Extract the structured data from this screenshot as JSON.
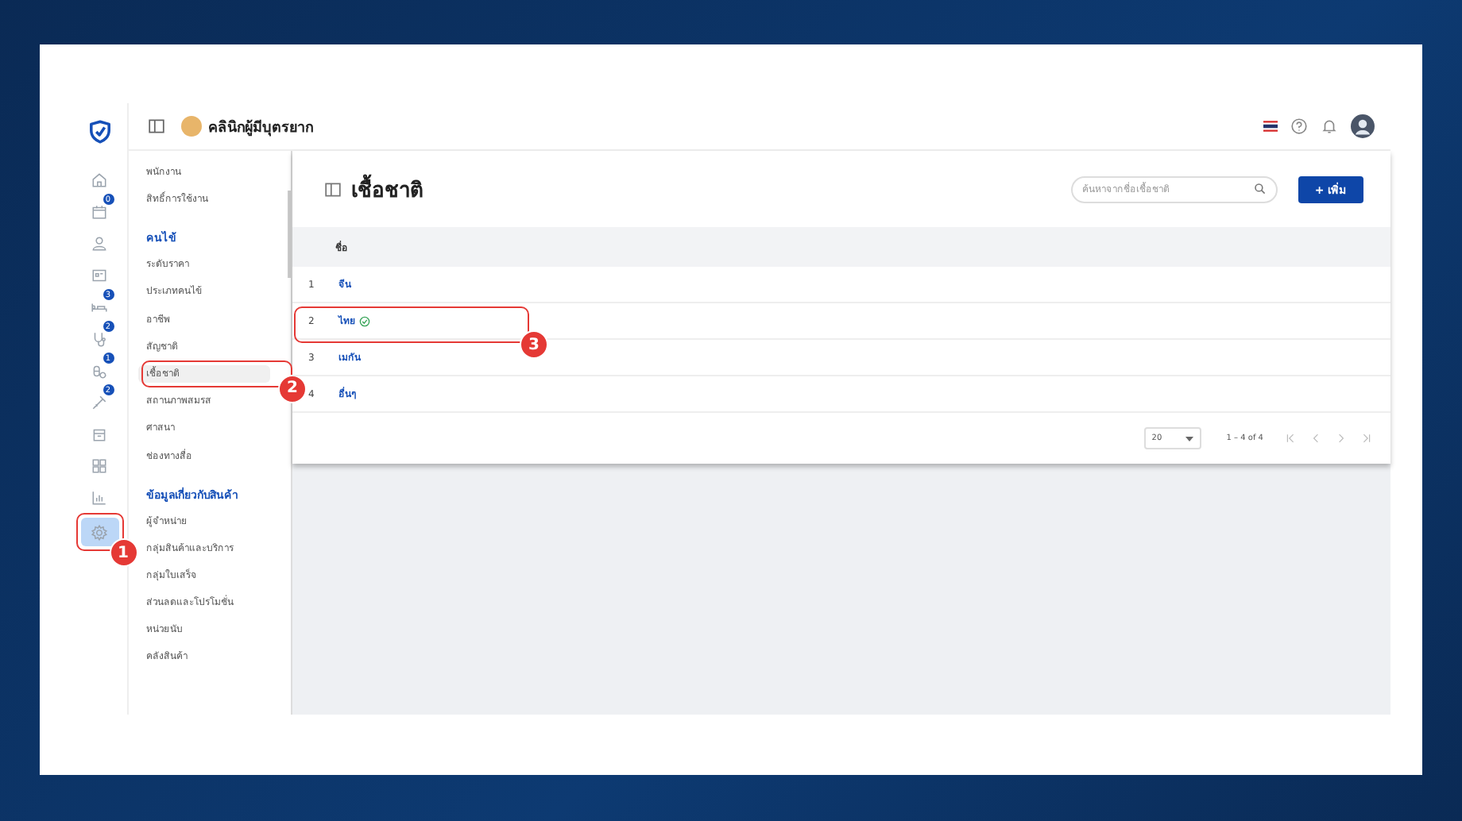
{
  "header": {
    "clinic_name": "คลินิกผู้มีบุตรยาก"
  },
  "rail": [
    {
      "selected": false
    },
    {
      "badge": "0",
      "selected": false
    },
    {
      "selected": false
    },
    {
      "selected": false
    },
    {
      "badge": "3",
      "selected": false
    },
    {
      "badge": "2",
      "selected": false
    },
    {
      "badge": "1",
      "selected": false
    },
    {
      "badge": "2",
      "selected": false
    },
    {
      "selected": false
    },
    {
      "selected": false
    },
    {
      "selected": false
    },
    {
      "selected": true,
      "callout": "1"
    }
  ],
  "sidebar": {
    "groups": [
      {
        "items": [
          {
            "label": "พนักงาน",
            "selected": false
          },
          {
            "label": "สิทธิ์การใช้งาน",
            "selected": false
          }
        ]
      },
      {
        "title": "คนไข้",
        "items": [
          {
            "label": "ระดับราคา",
            "selected": false
          },
          {
            "label": "ประเภทคนไข้",
            "selected": false
          },
          {
            "label": "อาชีพ",
            "selected": false
          },
          {
            "label": "สัญชาติ",
            "selected": false
          },
          {
            "label": "เชื้อชาติ",
            "selected": true,
            "callout": "2"
          },
          {
            "label": "สถานภาพสมรส",
            "selected": false
          },
          {
            "label": "ศาสนา",
            "selected": false
          },
          {
            "label": "ช่องทางสื่อ",
            "selected": false
          }
        ]
      },
      {
        "title": "ข้อมูลเกี่ยวกับสินค้า",
        "items": [
          {
            "label": "ผู้จำหน่าย",
            "selected": false
          },
          {
            "label": "กลุ่มสินค้าและบริการ",
            "selected": false
          },
          {
            "label": "กลุ่มใบเสร็จ",
            "selected": false
          },
          {
            "label": "ส่วนลดและโปรโมชั่น",
            "selected": false
          },
          {
            "label": "หน่วยนับ",
            "selected": false
          },
          {
            "label": "คลังสินค้า",
            "selected": false
          }
        ]
      }
    ]
  },
  "page": {
    "title": "เชื้อชาติ",
    "search": {
      "placeholder": "ค้นหาจากชื่อเชื้อชาติ"
    },
    "add_button": "+ เพิ่ม"
  },
  "table": {
    "columns": [
      "ชื่อ"
    ],
    "rows": [
      {
        "index": "1",
        "name": "จีน",
        "verified": false
      },
      {
        "index": "2",
        "name": "ไทย",
        "verified": true,
        "callout": "3"
      },
      {
        "index": "3",
        "name": "เมกัน",
        "verified": false
      },
      {
        "index": "4",
        "name": "อื่นๆ",
        "verified": false
      }
    ]
  },
  "pagination": {
    "page_size": "20",
    "range": "1 – 4 of 4"
  }
}
